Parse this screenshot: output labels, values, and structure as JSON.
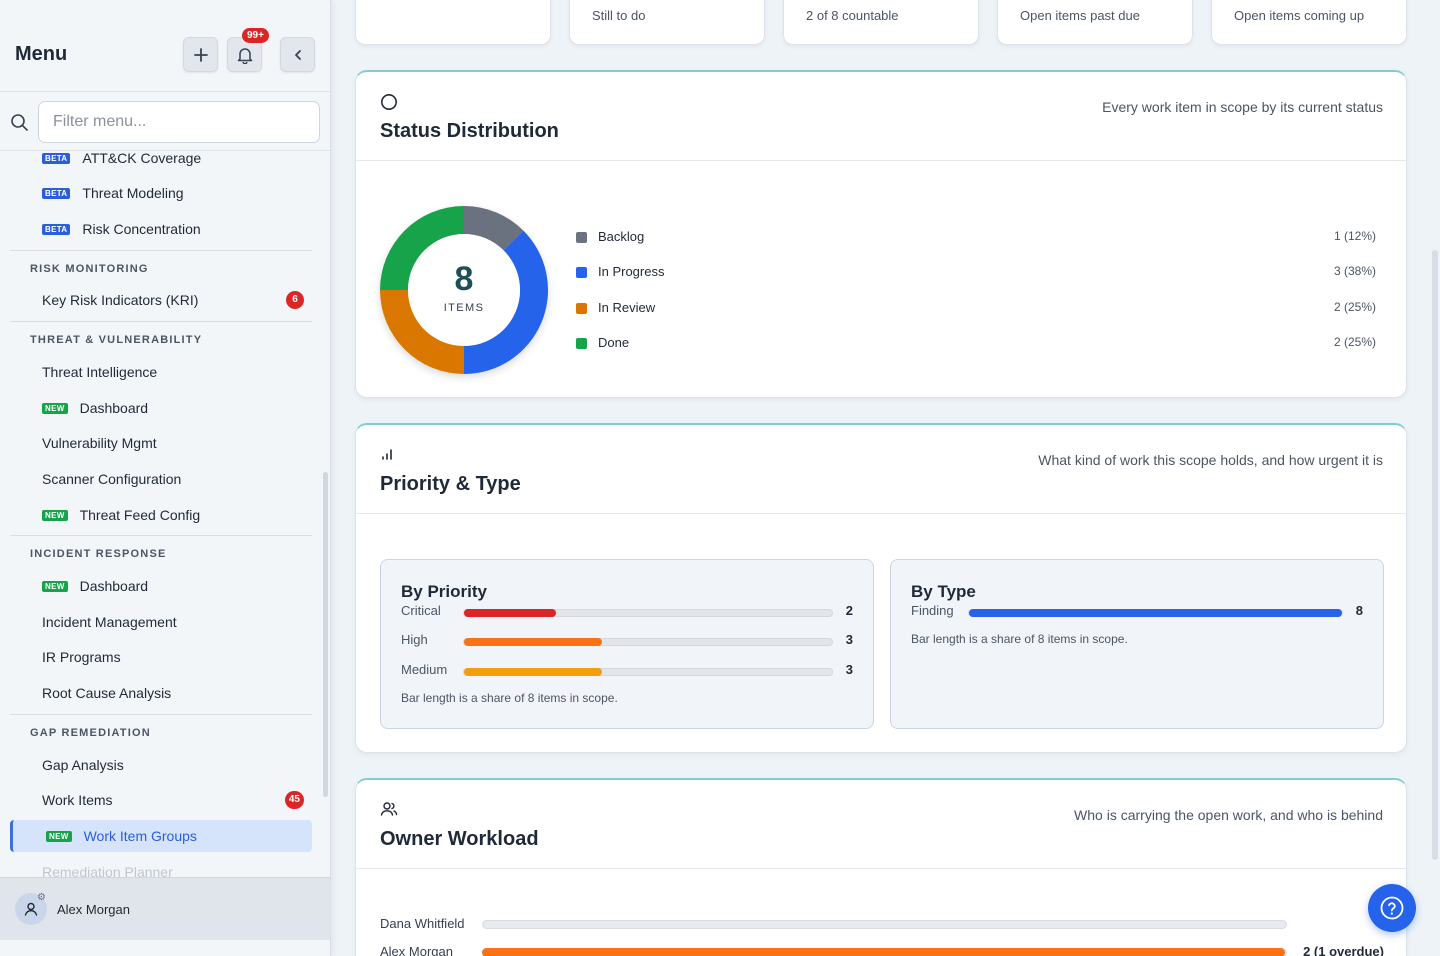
{
  "sidebar": {
    "title": "Menu",
    "notification_badge": "99+",
    "filter_placeholder": "Filter menu...",
    "items_top": [
      {
        "tag": "BETA",
        "label": "ATT&CK Coverage"
      },
      {
        "tag": "BETA",
        "label": "Threat Modeling"
      },
      {
        "tag": "BETA",
        "label": "Risk Concentration"
      }
    ],
    "sections": [
      {
        "title": "RISK MONITORING",
        "items": [
          {
            "label": "Key Risk Indicators (KRI)",
            "count": "6"
          }
        ]
      },
      {
        "title": "THREAT & VULNERABILITY",
        "items": [
          {
            "label": "Threat Intelligence"
          },
          {
            "tag": "NEW",
            "label": "Dashboard"
          },
          {
            "label": "Vulnerability Mgmt"
          },
          {
            "label": "Scanner Configuration"
          },
          {
            "tag": "NEW",
            "label": "Threat Feed Config"
          }
        ]
      },
      {
        "title": "INCIDENT RESPONSE",
        "items": [
          {
            "tag": "NEW",
            "label": "Dashboard"
          },
          {
            "label": "Incident Management"
          },
          {
            "label": "IR Programs"
          },
          {
            "label": "Root Cause Analysis"
          }
        ]
      },
      {
        "title": "GAP REMEDIATION",
        "items": [
          {
            "label": "Gap Analysis"
          },
          {
            "label": "Work Items",
            "count": "45"
          },
          {
            "tag": "NEW",
            "label": "Work Item Groups",
            "active": true
          },
          {
            "label": "Remediation Planner"
          }
        ]
      }
    ],
    "user_name": "Alex Morgan"
  },
  "top_cards": [
    "",
    "Still to do",
    "2 of 8 countable",
    "Open items past due",
    "Open items coming up"
  ],
  "status": {
    "title": "Status Distribution",
    "subtitle": "Every work item in scope by its current status",
    "total": "8",
    "total_label": "ITEMS",
    "legend": [
      {
        "name": "Backlog",
        "value": "1 (12%)",
        "color": "#6b7280"
      },
      {
        "name": "In Progress",
        "value": "3 (38%)",
        "color": "#2563eb"
      },
      {
        "name": "In Review",
        "value": "2 (25%)",
        "color": "#d97706"
      },
      {
        "name": "Done",
        "value": "2 (25%)",
        "color": "#16a34a"
      }
    ]
  },
  "priority_type": {
    "title": "Priority & Type",
    "subtitle": "What kind of work this scope holds, and how urgent it is",
    "by_priority": {
      "title": "By Priority",
      "rows": [
        {
          "label": "Critical",
          "value": "2",
          "share": 0.25,
          "color": "#dc2626"
        },
        {
          "label": "High",
          "value": "3",
          "share": 0.375,
          "color": "#f97316"
        },
        {
          "label": "Medium",
          "value": "3",
          "share": 0.375,
          "color": "#f59e0b"
        }
      ],
      "note": "Bar length is a share of 8 items in scope."
    },
    "by_type": {
      "title": "By Type",
      "rows": [
        {
          "label": "Finding",
          "value": "8",
          "share": 1.0,
          "color": "#2563eb"
        }
      ],
      "note": "Bar length is a share of 8 items in scope."
    }
  },
  "owner_workload": {
    "title": "Owner Workload",
    "subtitle": "Who is carrying the open work, and who is behind",
    "rows": [
      {
        "name": "Dana Whitfield",
        "value": "",
        "share": 0
      },
      {
        "name": "Alex Morgan",
        "value": "2 (1 overdue)",
        "share": 1.0
      }
    ]
  },
  "chart_data": {
    "type": "pie",
    "categories": [
      "Backlog",
      "In Progress",
      "In Review",
      "Done"
    ],
    "values": [
      1,
      3,
      2,
      2
    ],
    "title": "Status Distribution"
  }
}
